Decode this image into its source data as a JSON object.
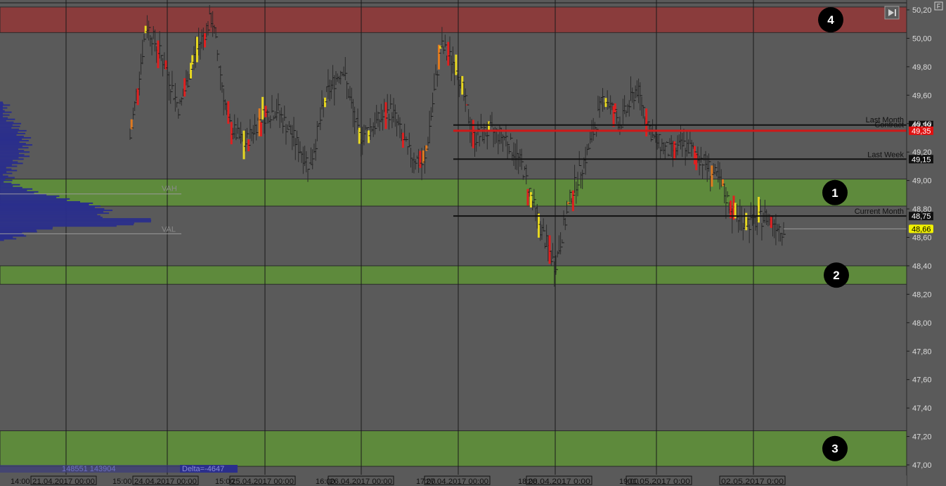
{
  "chart_data": {
    "type": "line",
    "title": "",
    "xlabel": "",
    "ylabel": "",
    "ylim": [
      46.95,
      50.25
    ],
    "grid": true,
    "y_ticks": [
      "50,20",
      "50,00",
      "49,80",
      "49,60",
      "49,40",
      "49,20",
      "49,00",
      "48,80",
      "48,60",
      "48,40",
      "48,20",
      "48,00",
      "47,80",
      "47,60",
      "47,40",
      "47,20",
      "47,00"
    ],
    "y_tick_values": [
      50.2,
      50.0,
      49.8,
      49.6,
      49.4,
      49.2,
      49.0,
      48.8,
      48.6,
      48.4,
      48.2,
      48.0,
      47.8,
      47.6,
      47.4,
      47.2,
      47.0
    ],
    "x_time_labels": [
      "14:00",
      "15:00",
      "15:00",
      "16:00",
      "17:00",
      "18:00",
      "19:00"
    ],
    "x_date_labels": [
      "21.04.2017 00:00",
      "24.04.2017 00:00",
      "25.04.2017 00:00",
      "26.04.2017 00:00",
      "27.04.2017 00:00",
      "28.04.2017 0:00",
      "01.05.2017 0:00",
      "02.05.2017 0:00"
    ],
    "zones": [
      {
        "label": "4",
        "from": 50.04,
        "to": 50.22,
        "color": "#8a3c3c"
      },
      {
        "label": "1",
        "from": 48.82,
        "to": 49.01,
        "color": "#5e8a3c"
      },
      {
        "label": "2",
        "from": 48.27,
        "to": 48.4,
        "color": "#5e8a3c"
      },
      {
        "label": "3",
        "from": 46.99,
        "to": 47.24,
        "color": "#5e8a3c"
      }
    ],
    "levels": [
      {
        "name": "Last Month",
        "value": 49.39,
        "label": "49,39",
        "color": "#111111",
        "badge_bg": "#111111",
        "badge_fg": "#ffffff"
      },
      {
        "name": "Contract",
        "value": 49.35,
        "label": "49,35",
        "color": "#d01818",
        "badge_bg": "#e01010",
        "badge_fg": "#ffffff"
      },
      {
        "name": "Last Week",
        "value": 49.15,
        "label": "49,15",
        "color": "#111111",
        "badge_bg": "#111111",
        "badge_fg": "#ffffff"
      },
      {
        "name": "Current Month",
        "value": 48.75,
        "label": "48,75",
        "color": "#111111",
        "badge_bg": "#111111",
        "badge_fg": "#ffffff"
      }
    ],
    "last_price": {
      "value": 48.66,
      "label": "48,66",
      "badge_bg": "#f0f000",
      "badge_fg": "#000000"
    },
    "volume_profile": {
      "vah_label": "VAH",
      "val_label": "VAL",
      "vah": 48.95,
      "val": 48.65,
      "color": "#2a2e8c"
    },
    "footer_stats": {
      "values": "148551 143904",
      "delta": "Delta=-4647"
    },
    "series": [
      {
        "values": [
          49.3,
          50.1,
          49.85,
          49.5,
          49.9,
          50.15,
          49.4,
          49.25,
          49.45,
          49.5,
          49.3,
          49.1,
          49.6,
          49.8,
          49.3,
          49.4,
          49.5,
          49.2,
          49.1,
          49.95,
          49.8,
          49.3,
          49.35,
          49.3,
          49.1,
          48.7,
          48.4,
          48.9,
          49.2,
          49.6,
          49.4,
          49.65,
          49.3,
          49.2,
          49.25,
          49.15,
          49.0,
          48.75,
          48.7,
          48.75,
          48.65
        ]
      }
    ]
  },
  "ui": {
    "skip_button_icon": "skip-to-end-icon",
    "corner_badge": "F"
  }
}
